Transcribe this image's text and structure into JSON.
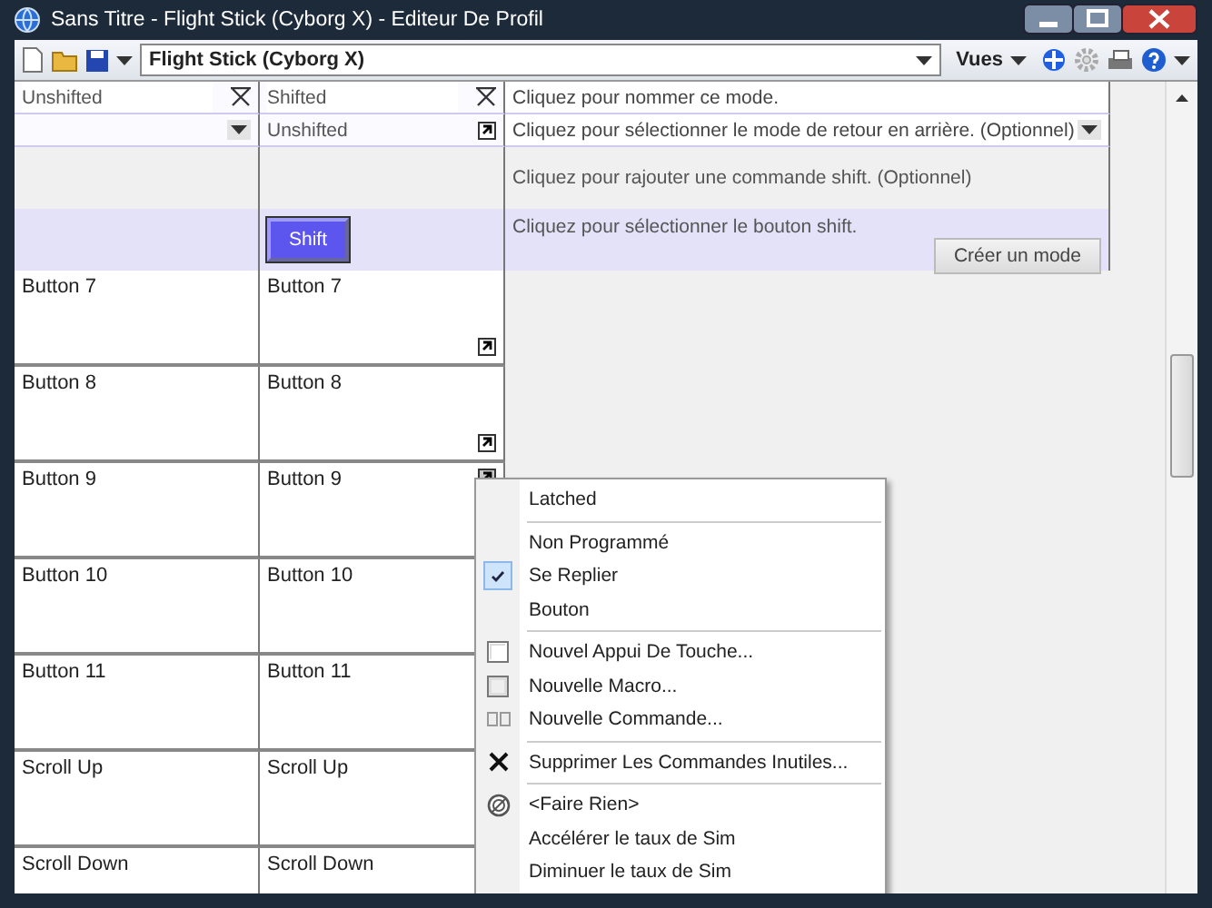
{
  "window": {
    "title": "Sans Titre - Flight Stick (Cyborg X) - Editeur De Profil"
  },
  "toolbar": {
    "profile": "Flight Stick (Cyborg X)",
    "views": "Vues"
  },
  "modes": [
    {
      "name": "Unshifted"
    },
    {
      "name": "Shifted",
      "fallback": "Unshifted",
      "shift_button": "Shift"
    }
  ],
  "hints": {
    "name": "Cliquez pour nommer ce mode.",
    "fallback": "Cliquez pour sélectionner le mode de retour en arrière. (Optionnel)",
    "command": "Cliquez pour rajouter une commande shift. (Optionnel)",
    "button": "Cliquez pour sélectionner le bouton shift."
  },
  "create_button": "Créer un mode",
  "rows": [
    {
      "unshifted": "Button 7",
      "shifted": "Button 7",
      "fallback_mark": true,
      "menu_open": false
    },
    {
      "unshifted": "Button 8",
      "shifted": "Button 8",
      "fallback_mark": true,
      "menu_open": false
    },
    {
      "unshifted": "Button 9",
      "shifted": "Button 9",
      "fallback_mark": true,
      "menu_open": true
    },
    {
      "unshifted": "Button 10",
      "shifted": "Button 10",
      "fallback_mark": false
    },
    {
      "unshifted": "Button 11",
      "shifted": "Button 11",
      "fallback_mark": false
    },
    {
      "unshifted": "Scroll Up",
      "shifted": "Scroll Up",
      "fallback_mark": false
    },
    {
      "unshifted": "Scroll Down",
      "shifted": "Scroll Down",
      "fallback_mark": false
    }
  ],
  "context_menu": [
    {
      "kind": "plain",
      "label": "Latched",
      "checked": false
    },
    {
      "kind": "separator"
    },
    {
      "kind": "plain",
      "label": "Non Programmé",
      "checked": false
    },
    {
      "kind": "plain",
      "label": "Se Replier",
      "checked": true
    },
    {
      "kind": "plain",
      "label": "Bouton",
      "checked": false
    },
    {
      "kind": "separator"
    },
    {
      "kind": "keypress",
      "label": "Nouvel Appui De Touche...",
      "checked": false
    },
    {
      "kind": "macro",
      "label": "Nouvelle Macro...",
      "checked": false
    },
    {
      "kind": "command",
      "label": "Nouvelle Commande...",
      "checked": false
    },
    {
      "kind": "separator"
    },
    {
      "kind": "delete",
      "label": "Supprimer Les Commandes Inutiles...",
      "checked": false
    },
    {
      "kind": "separator"
    },
    {
      "kind": "nothing",
      "label": "<Faire Rien>",
      "checked": false
    },
    {
      "kind": "plain",
      "label": "Accélérer le taux de Sim",
      "checked": false
    },
    {
      "kind": "plain",
      "label": "Diminuer le taux de Sim",
      "checked": false
    }
  ]
}
